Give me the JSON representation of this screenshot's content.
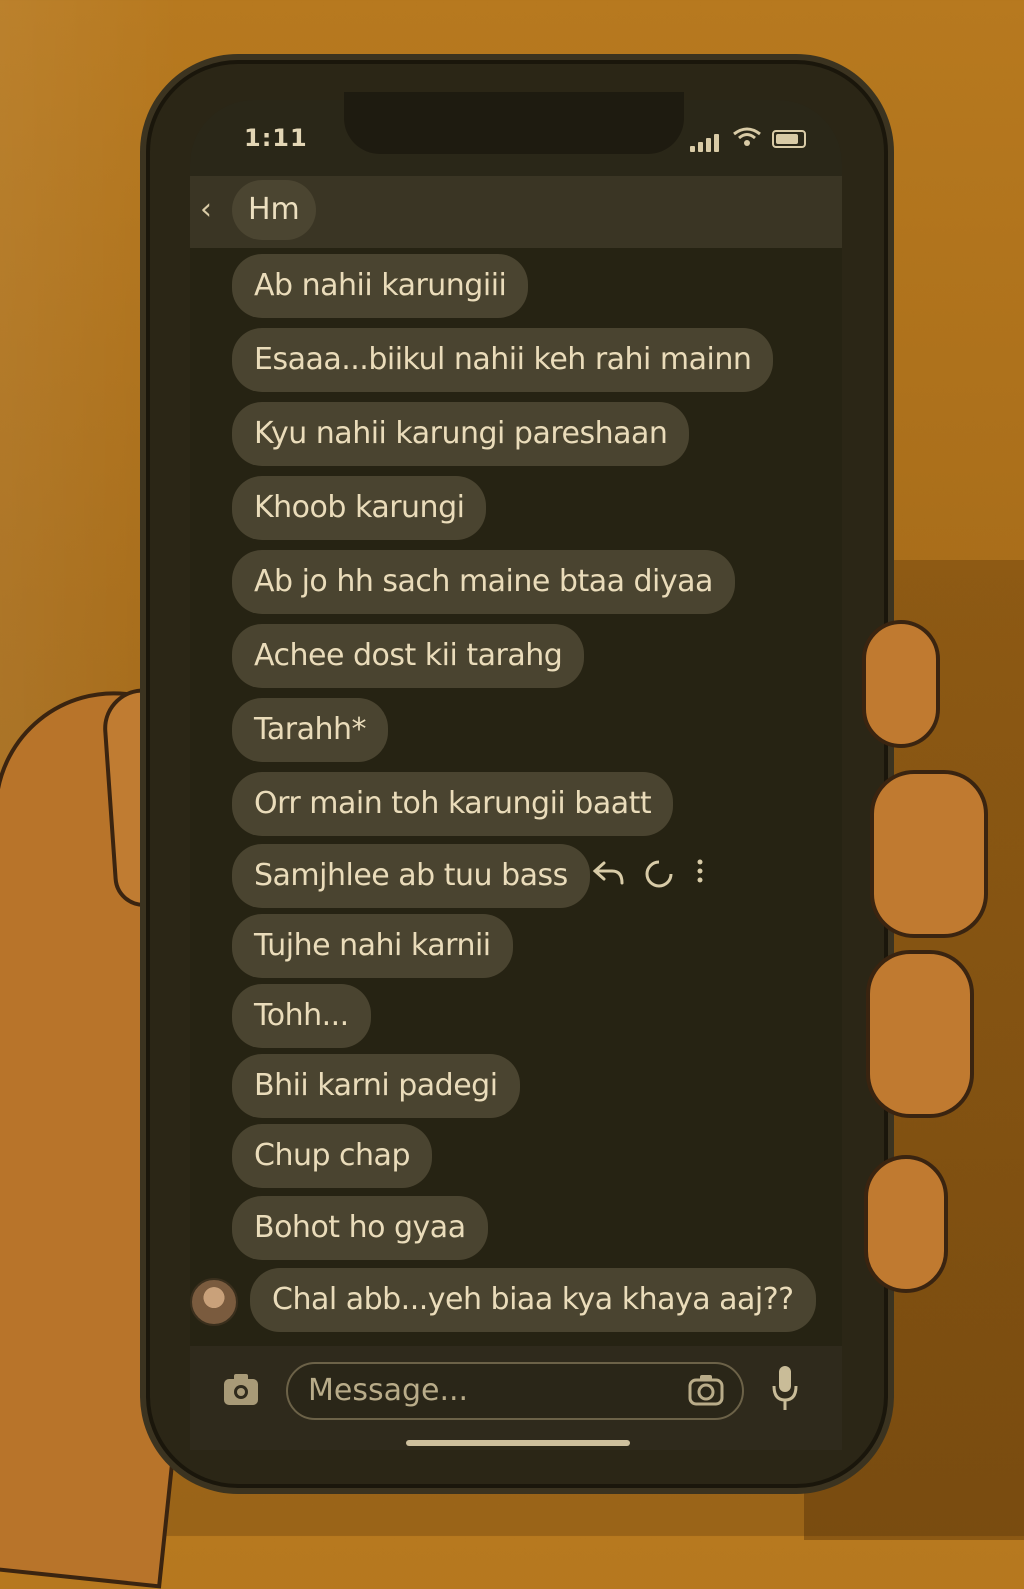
{
  "status_bar": {
    "time": "1:11"
  },
  "header": {
    "back_icon": "chevron-left-icon",
    "title": "Hm"
  },
  "messages": [
    {
      "text": "Ab nahii karungiii"
    },
    {
      "text": "Esaaa...biikul nahii keh rahi mainn"
    },
    {
      "text": "Kyu nahii karungi pareshaan"
    },
    {
      "text": "Khoob karungi"
    },
    {
      "text": "Ab jo hh sach maine btaa diyaa"
    },
    {
      "text": "Achee dost kii tarahg"
    },
    {
      "text": "Tarahh*"
    },
    {
      "text": "Orr main toh karungii baatt"
    },
    {
      "text": "Samjhlee ab tuu bass"
    },
    {
      "text": "Tujhe nahi karnii"
    },
    {
      "text": "Tohh..."
    },
    {
      "text": "Bhii karni padegi"
    },
    {
      "text": "Chup chap"
    },
    {
      "text": "Bohot ho gyaa"
    },
    {
      "text": "Chal abb...yeh biaa kya khaya aaj??"
    }
  ],
  "message_actions": {
    "reply_icon": "reply-icon",
    "react_icon": "emoji-icon",
    "more_icon": "more-icon"
  },
  "composer": {
    "placeholder": "Message...",
    "camera_icon": "camera-icon",
    "mic_icon": "mic-icon"
  }
}
